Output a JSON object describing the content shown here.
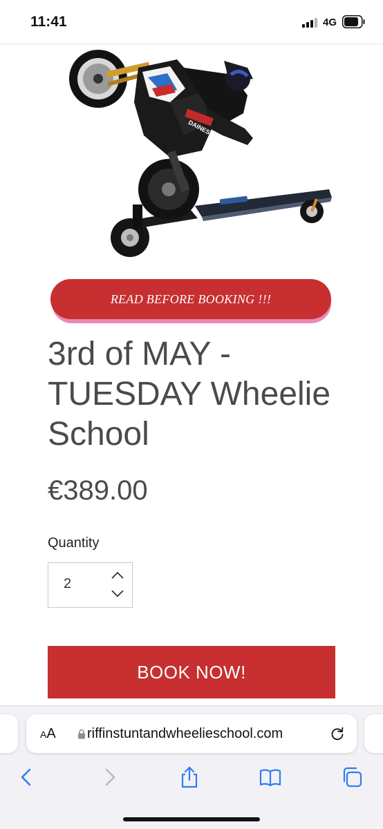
{
  "status_bar": {
    "time": "11:41",
    "network": "4G",
    "icons": [
      "signal-icon",
      "battery-icon"
    ]
  },
  "hero": {
    "icon": "wheelie-motorcycle-image",
    "brand_text": "DAINESE"
  },
  "read_before_booking": "READ BEFORE BOOKING !!!",
  "product": {
    "title": "3rd of MAY - TUESDAY Wheelie School",
    "price": "€389.00"
  },
  "quantity": {
    "label": "Quantity",
    "value": "2"
  },
  "book_button": "BOOK NOW!",
  "browser": {
    "aa_small": "A",
    "aa_large": "A",
    "url": "riffinstuntandwheelieschool.com",
    "icons": [
      "back-icon",
      "forward-icon",
      "share-icon",
      "bookmarks-icon",
      "tabs-icon",
      "reload-icon",
      "lock-icon"
    ]
  },
  "colors": {
    "accent_red": "#c72f30",
    "pink_shadow": "#e88ab6",
    "text_gray": "#4a4a4a",
    "ios_blue": "#2f7cf6"
  }
}
